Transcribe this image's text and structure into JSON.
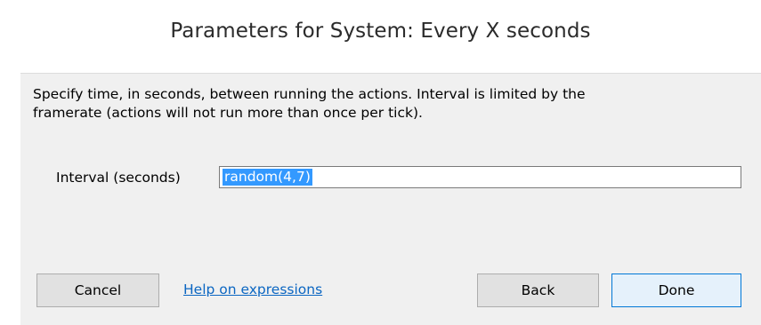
{
  "window": {
    "title": "Parameters for System: Every X seconds"
  },
  "description": {
    "line1": "Specify time, in seconds, between running the actions.  Interval is limited by the",
    "line2": "framerate (actions will not run more than once per tick)."
  },
  "interval": {
    "label": "Interval (seconds)",
    "value": "random(4,7)",
    "selected": true
  },
  "buttons": {
    "cancel": "Cancel",
    "back": "Back",
    "done": "Done"
  },
  "help_link": {
    "label": "Help on expressions"
  },
  "colors": {
    "selection": "#3399ff",
    "link": "#0b66c2",
    "panel_background": "#f0f0f0",
    "default_button_border": "#0078d7"
  }
}
